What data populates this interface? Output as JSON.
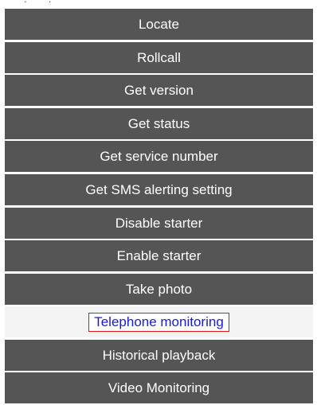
{
  "menu": {
    "items": [
      {
        "label": "Locate"
      },
      {
        "label": "Rollcall"
      },
      {
        "label": "Get version"
      },
      {
        "label": "Get status"
      },
      {
        "label": "Get service number"
      },
      {
        "label": "Get SMS alerting setting"
      },
      {
        "label": "Disable starter"
      },
      {
        "label": "Enable starter"
      },
      {
        "label": "Take photo"
      },
      {
        "label": "Telephone monitoring",
        "active": true
      },
      {
        "label": "Historical playback"
      },
      {
        "label": "Video Monitoring"
      }
    ],
    "colors": {
      "item_bg": "#555555",
      "item_text": "#ffffff",
      "active_bg": "#f3f3f3",
      "active_text": "#1a1ad6",
      "active_border": "#e01818"
    }
  }
}
